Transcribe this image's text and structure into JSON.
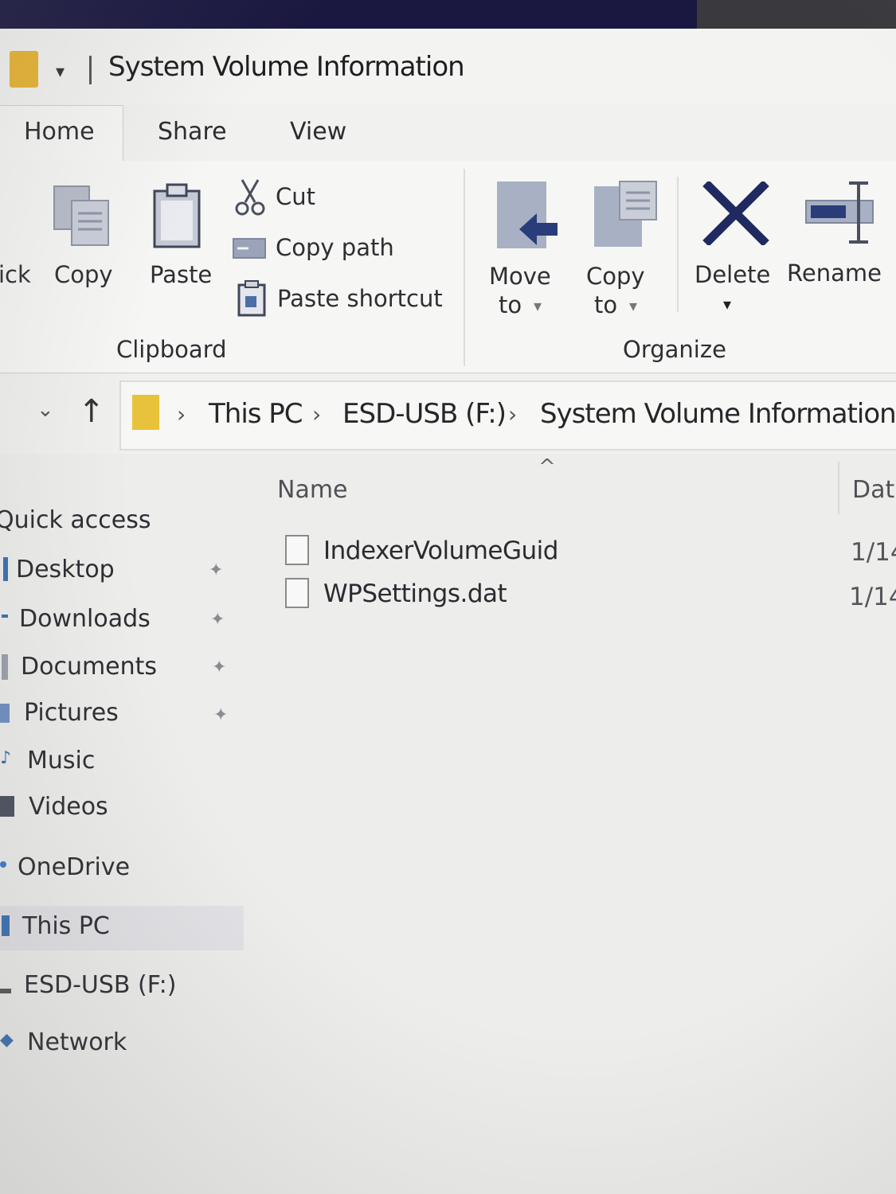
{
  "window": {
    "title": "System Volume Information",
    "qat_dropdown_glyph": "▾"
  },
  "ribbon": {
    "tabs": [
      "Home",
      "Share",
      "View"
    ],
    "clipboard": {
      "quick_access_partial": "ick",
      "copy": "Copy",
      "paste": "Paste",
      "cut": "Cut",
      "copy_path": "Copy path",
      "paste_shortcut": "Paste shortcut",
      "group_label": "Clipboard"
    },
    "organize": {
      "move_to_line1": "Move",
      "move_to_line2": "to",
      "copy_to_line1": "Copy",
      "copy_to_line2": "to",
      "delete": "Delete",
      "rename": "Rename",
      "group_label": "Organize"
    }
  },
  "navigation": {
    "recent_glyph": "⌄",
    "up_glyph": "↑",
    "breadcrumb": [
      "This PC",
      "ESD-USB (F:)",
      "System Volume Information"
    ],
    "separator": "›"
  },
  "file_list": {
    "sort_glyph": "^",
    "columns": {
      "name": "Name",
      "date": "Dat"
    },
    "files": [
      {
        "name": "IndexerVolumeGuid",
        "date": "1/14"
      },
      {
        "name": "WPSettings.dat",
        "date": "1/14"
      }
    ]
  },
  "sidebar": {
    "quick_access": "Quick access",
    "pinned": [
      "Desktop",
      "Downloads",
      "Documents",
      "Pictures"
    ],
    "items": [
      "Music",
      "Videos"
    ],
    "onedrive": "OneDrive",
    "this_pc": "This PC",
    "drive": "ESD-USB (F:)",
    "network": "Network"
  },
  "colors": {
    "folder": "#e8b431",
    "accent_blue": "#2a3d7a",
    "icon_gray": "#9aa3b8"
  }
}
